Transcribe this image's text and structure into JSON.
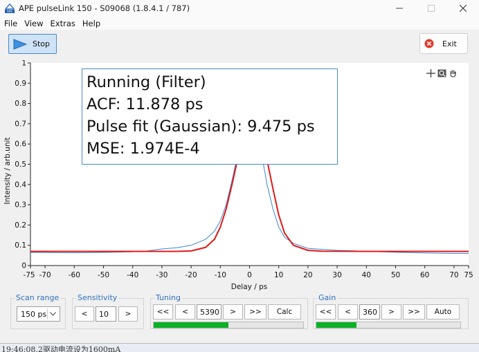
{
  "window": {
    "title": "APE pulseLink 150 - S09068 (1.8.4.1 / 787)",
    "app_icon": "ape-logo-icon",
    "controls": [
      "minimize",
      "maximize",
      "close"
    ]
  },
  "menu": [
    "File",
    "View",
    "Extras",
    "Help"
  ],
  "toolbar": {
    "stop_label": "Stop",
    "exit_label": "Exit"
  },
  "fit_info": {
    "lines": [
      "Running (Filter)",
      "ACF: 11.878 ps",
      "Pulse fit (Gaussian): 9.475 ps",
      "MSE: 1.974E-4"
    ]
  },
  "plot_tools": [
    "crosshair-icon",
    "zoom-icon",
    "pan-hand-icon"
  ],
  "chart_data": {
    "type": "line",
    "xlabel": "Delay / ps",
    "ylabel": "Intensity / arb.unit",
    "xlim": [
      -75,
      75
    ],
    "ylim": [
      0,
      1
    ],
    "x_ticks": [
      -75,
      -70,
      -60,
      -50,
      -40,
      -30,
      -20,
      -10,
      0,
      10,
      20,
      30,
      40,
      50,
      60,
      70,
      75
    ],
    "y_ticks": [
      0,
      0.1,
      0.2,
      0.3,
      0.4,
      0.5,
      0.6,
      0.7,
      0.8,
      0.9,
      1
    ],
    "grid": false,
    "series": [
      {
        "color": "#3a86d1",
        "x": [
          -75,
          -60,
          -50,
          -40,
          -35,
          -30,
          -25,
          -20,
          -15,
          -12,
          -10,
          -8,
          -6,
          -4,
          -3,
          -2,
          -1,
          0,
          1,
          2,
          3,
          4,
          5,
          6,
          8,
          10,
          12,
          15,
          20,
          25,
          30,
          35,
          40,
          50,
          60,
          70,
          75
        ],
        "y": [
          0.065,
          0.063,
          0.065,
          0.068,
          0.072,
          0.082,
          0.088,
          0.1,
          0.13,
          0.17,
          0.22,
          0.3,
          0.42,
          0.55,
          0.62,
          0.68,
          0.72,
          0.74,
          0.73,
          0.69,
          0.63,
          0.56,
          0.48,
          0.4,
          0.28,
          0.19,
          0.14,
          0.11,
          0.085,
          0.08,
          0.075,
          0.073,
          0.07,
          0.066,
          0.062,
          0.06,
          0.06
        ]
      },
      {
        "color": "#e01818",
        "x": [
          -75,
          -60,
          -40,
          -25,
          -20,
          -15,
          -12,
          -10,
          -8,
          -6,
          -4,
          -2,
          0,
          1,
          2,
          4,
          6,
          8,
          10,
          12,
          15,
          20,
          25,
          40,
          60,
          75
        ],
        "y": [
          0.07,
          0.07,
          0.07,
          0.07,
          0.072,
          0.09,
          0.13,
          0.19,
          0.28,
          0.4,
          0.53,
          0.64,
          0.69,
          0.7,
          0.69,
          0.64,
          0.52,
          0.38,
          0.25,
          0.16,
          0.1,
          0.075,
          0.071,
          0.07,
          0.07,
          0.07
        ]
      }
    ]
  },
  "scan_range": {
    "title": "Scan range",
    "value": "150 ps"
  },
  "sensitivity": {
    "title": "Sensitivity",
    "dec": "<",
    "value": "10",
    "inc": ">"
  },
  "tuning": {
    "title": "Tuning",
    "fast_back": "<<",
    "back": "<",
    "value": "5390",
    "fwd": ">",
    "fast_fwd": ">>",
    "calc": "Calc",
    "level": 0.5
  },
  "gain": {
    "title": "Gain",
    "fast_back": "<<",
    "back": "<",
    "value": "360",
    "fwd": ">",
    "fast_fwd": ">>",
    "auto": "Auto",
    "level": 0.28
  },
  "status_text": "19:46:08.2驱动电流设为1600mA"
}
